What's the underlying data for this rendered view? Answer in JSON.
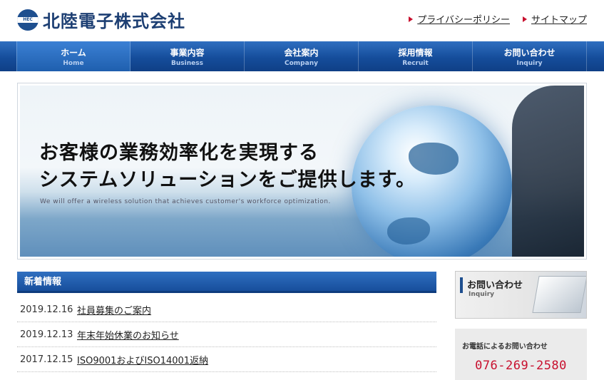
{
  "header": {
    "logo_mark_text": "HEC",
    "company_name": "北陸電子株式会社",
    "links": [
      {
        "label": "プライバシーポリシー"
      },
      {
        "label": "サイトマップ"
      }
    ]
  },
  "nav": {
    "items": [
      {
        "jp": "ホーム",
        "en": "Home"
      },
      {
        "jp": "事業内容",
        "en": "Business"
      },
      {
        "jp": "会社案内",
        "en": "Company"
      },
      {
        "jp": "採用情報",
        "en": "Recruit"
      },
      {
        "jp": "お問い合わせ",
        "en": "Inquiry"
      }
    ]
  },
  "hero": {
    "title_line1": "お客様の業務効率化を実現する",
    "title_line2": "システムソリューションをご提供します。",
    "subtitle": "We will offer a wireless solution that achieves customer's workforce optimization."
  },
  "news": {
    "heading": "新着情報",
    "items": [
      {
        "date": "2019.12.16",
        "title": "社員募集のご案内"
      },
      {
        "date": "2019.12.13",
        "title": "年末年始休業のお知らせ"
      },
      {
        "date": "2017.12.15",
        "title": "ISO9001およびISO14001返納"
      }
    ]
  },
  "side": {
    "inquiry_jp": "お問い合わせ",
    "inquiry_en": "Inquiry",
    "phone_label": "お電話によるお問い合わせ",
    "phone_number": "076-269-2580"
  }
}
